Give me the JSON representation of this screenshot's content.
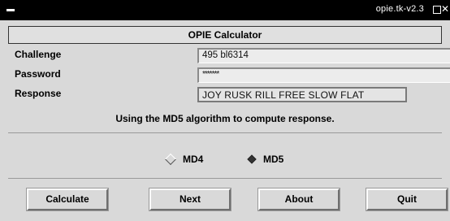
{
  "window": {
    "title": "opie.tk-v2.3"
  },
  "header": {
    "title": "OPIE Calculator"
  },
  "fields": {
    "challenge_label": "Challenge",
    "challenge_value": "495 bl6314",
    "password_label": "Password",
    "password_value": "*******",
    "response_label": "Response",
    "response_value": "JOY RUSK RILL FREE SLOW FLAT"
  },
  "status": {
    "text": "Using the MD5 algorithm to compute response."
  },
  "algorithm": {
    "options": [
      "MD4",
      "MD5"
    ],
    "selected": "MD5"
  },
  "buttons": {
    "calculate": "Calculate",
    "next": "Next",
    "about": "About",
    "quit": "Quit"
  }
}
